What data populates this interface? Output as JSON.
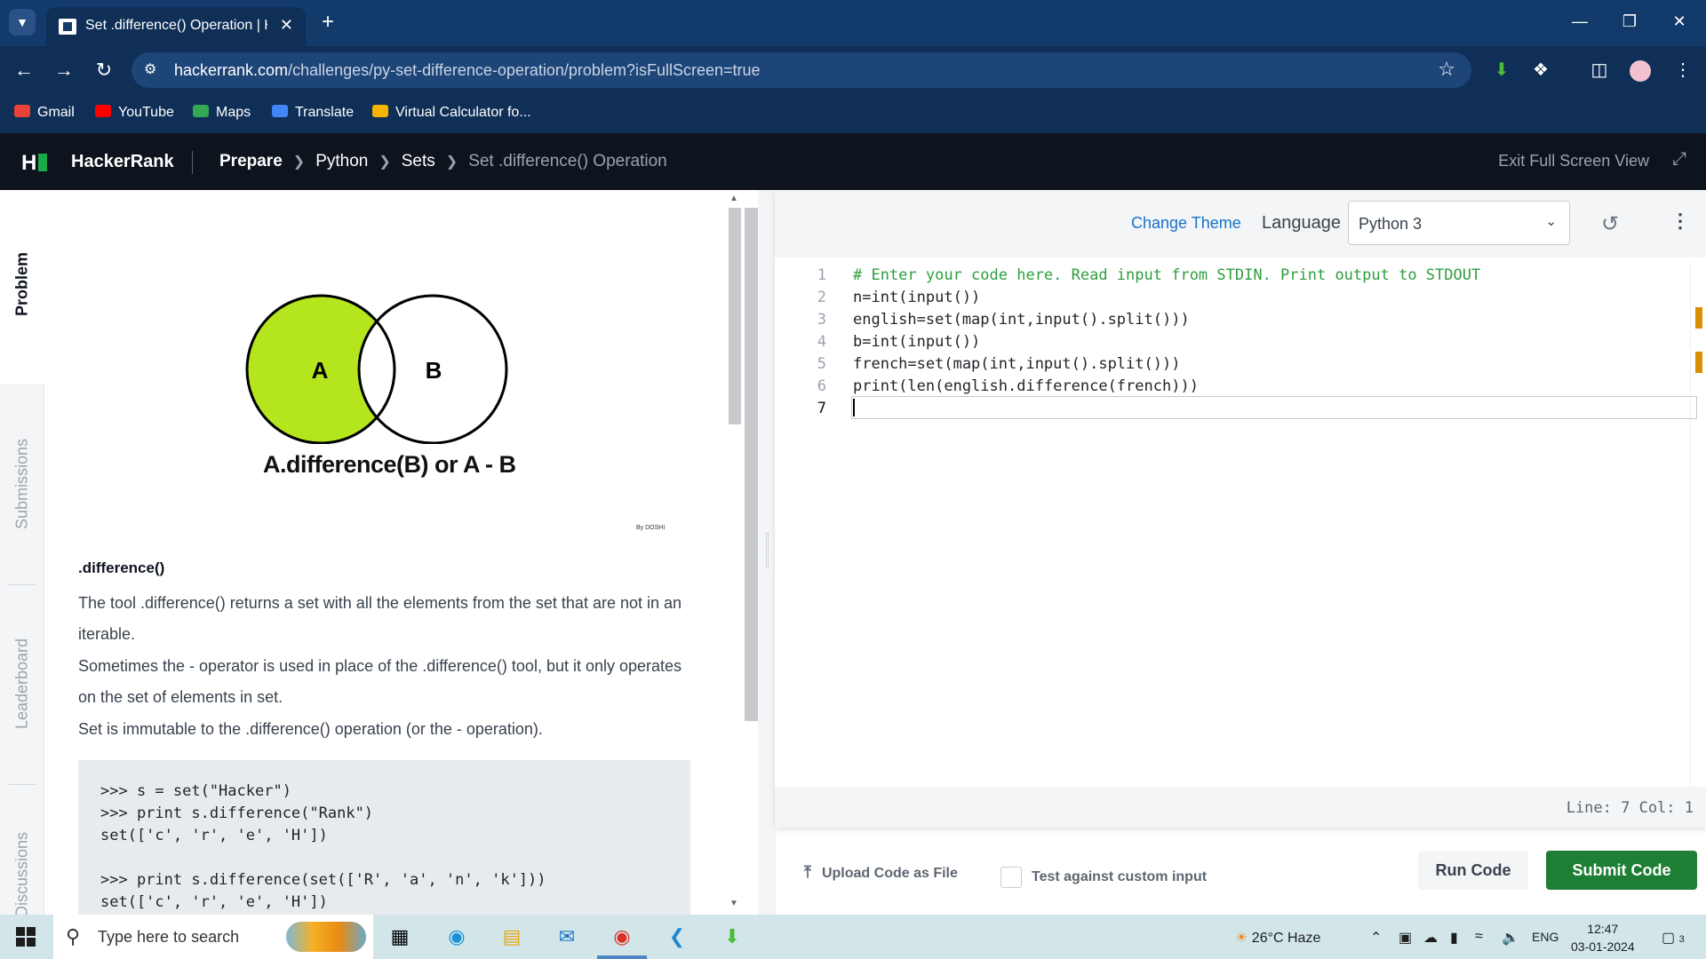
{
  "browser": {
    "tab_title": "Set .difference() Operation | HackerRank",
    "url_host": "hackerrank.com",
    "url_path": "/challenges/py-set-difference-operation/problem?isFullScreen=true",
    "bookmarks": [
      "Gmail",
      "YouTube",
      "Maps",
      "Translate",
      "Virtual Calculator fo..."
    ]
  },
  "header": {
    "brand": "HackerRank",
    "breadcrumbs": [
      "Prepare",
      "Python",
      "Sets",
      "Set .difference() Operation"
    ],
    "exit_fullscreen": "Exit Full Screen View"
  },
  "side_tabs": [
    "Problem",
    "Submissions",
    "Leaderboard",
    "Discussions"
  ],
  "problem": {
    "venn": {
      "left": "A",
      "right": "B",
      "caption": "A.difference(B) or A - B",
      "credit": "By DOSHI",
      "highlight_color": "#b5e61d"
    },
    "heading": ".difference()",
    "para1": "The tool .difference() returns a set with all the elements from the set that are not in an iterable.",
    "para2": "Sometimes the - operator is used in place of the .difference() tool, but it only operates on the set of elements in set.",
    "para3": "Set is immutable to the .difference() operation (or the - operation).",
    "code_example": ">>> s = set(\"Hacker\")\n>>> print s.difference(\"Rank\")\nset(['c', 'r', 'e', 'H'])\n\n>>> print s.difference(set(['R', 'a', 'n', 'k']))\nset(['c', 'r', 'e', 'H'])"
  },
  "editor": {
    "change_theme": "Change Theme",
    "language_label": "Language",
    "language_value": "Python 3",
    "lines": [
      "# Enter your code here. Read input from STDIN. Print output to STDOUT",
      "n=int(input())",
      "english=set(map(int,input().split()))",
      "b=int(input())",
      "french=set(map(int,input().split()))",
      "print(len(english.difference(french)))",
      ""
    ],
    "line_numbers": [
      "1",
      "2",
      "3",
      "4",
      "5",
      "6",
      "7"
    ],
    "status": "Line: 7 Col: 1"
  },
  "actions": {
    "upload": "Upload Code as File",
    "custom_input": "Test against custom input",
    "run": "Run Code",
    "submit": "Submit Code"
  },
  "taskbar": {
    "search_placeholder": "Type here to search",
    "weather": "26°C  Haze",
    "language": "ENG",
    "time": "12:47",
    "date": "03-01-2024",
    "notifications": "3"
  }
}
